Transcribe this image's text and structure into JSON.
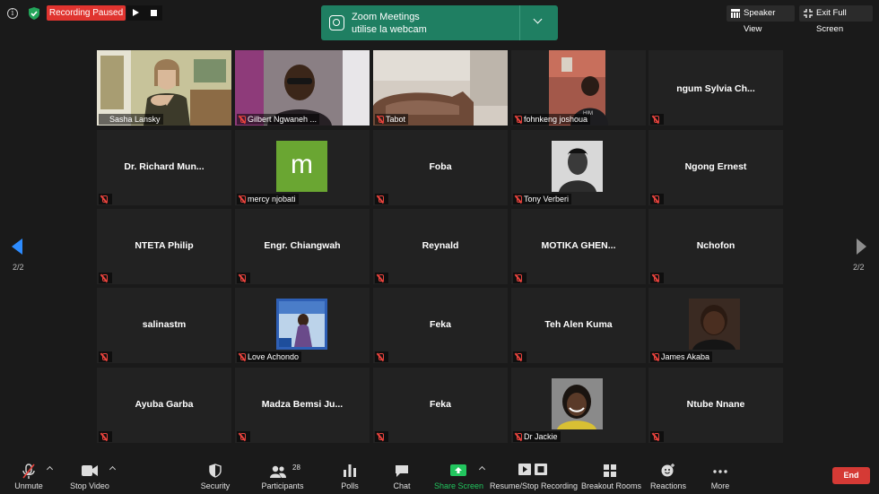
{
  "top": {
    "recording_label": "Recording Paused",
    "notification_title": "Zoom Meetings",
    "notification_subtitle": "utilise la webcam",
    "speaker_view_label": "Speaker View",
    "exit_full_label": "Exit Full Screen"
  },
  "gallery": {
    "page_indicator_left": "2/2",
    "page_indicator_right": "2/2",
    "rows": [
      [
        {
          "label": "Sasha Lansky",
          "name": "",
          "active": true
        },
        {
          "label": "Gilbert Ngwaneh ...",
          "name": ""
        },
        {
          "label": "Tabot",
          "name": ""
        },
        {
          "label": "fohnkeng joshoua",
          "name": ""
        },
        {
          "label": "",
          "name": "ngum  Sylvia  Ch..."
        }
      ],
      [
        {
          "label": "",
          "name": "Dr.  Richard  Mun..."
        },
        {
          "label": "mercy njobati",
          "name": ""
        },
        {
          "label": "",
          "name": "Foba"
        },
        {
          "label": "Tony Verberi",
          "name": ""
        },
        {
          "label": "",
          "name": "Ngong Ernest"
        }
      ],
      [
        {
          "label": "",
          "name": "NTETA Philip"
        },
        {
          "label": "",
          "name": "Engr.  Chiangwah"
        },
        {
          "label": "",
          "name": "Reynald"
        },
        {
          "label": "",
          "name": "MOTIKA  GHEN..."
        },
        {
          "label": "",
          "name": "Nchofon"
        }
      ],
      [
        {
          "label": "",
          "name": "salinastm"
        },
        {
          "label": "Love Achondo",
          "name": ""
        },
        {
          "label": "",
          "name": "Feka"
        },
        {
          "label": "",
          "name": "Teh Alen Kuma"
        },
        {
          "label": "James Akaba",
          "name": ""
        }
      ],
      [
        {
          "label": "",
          "name": "Ayuba Garba"
        },
        {
          "label": "",
          "name": "Madza  Bemsi  Ju..."
        },
        {
          "label": "",
          "name": "Feka"
        },
        {
          "label": "Dr Jackie",
          "name": ""
        },
        {
          "label": "",
          "name": "Ntube Nnane"
        }
      ]
    ],
    "avatar_letter": "m"
  },
  "toolbar": {
    "unmute": "Unmute",
    "stop_video": "Stop Video",
    "security": "Security",
    "participants": "Participants",
    "participants_count": "28",
    "polls": "Polls",
    "chat": "Chat",
    "share_screen": "Share Screen",
    "recording": "Resume/Stop Recording",
    "breakout": "Breakout Rooms",
    "reactions": "Reactions",
    "more": "More",
    "end": "End"
  },
  "colors": {
    "notification": "#1f7f62",
    "recording": "#e0342f",
    "end": "#d53a35",
    "share": "#22c55e",
    "active_speaker": "#f1f18a",
    "mute": "#e8433d"
  }
}
